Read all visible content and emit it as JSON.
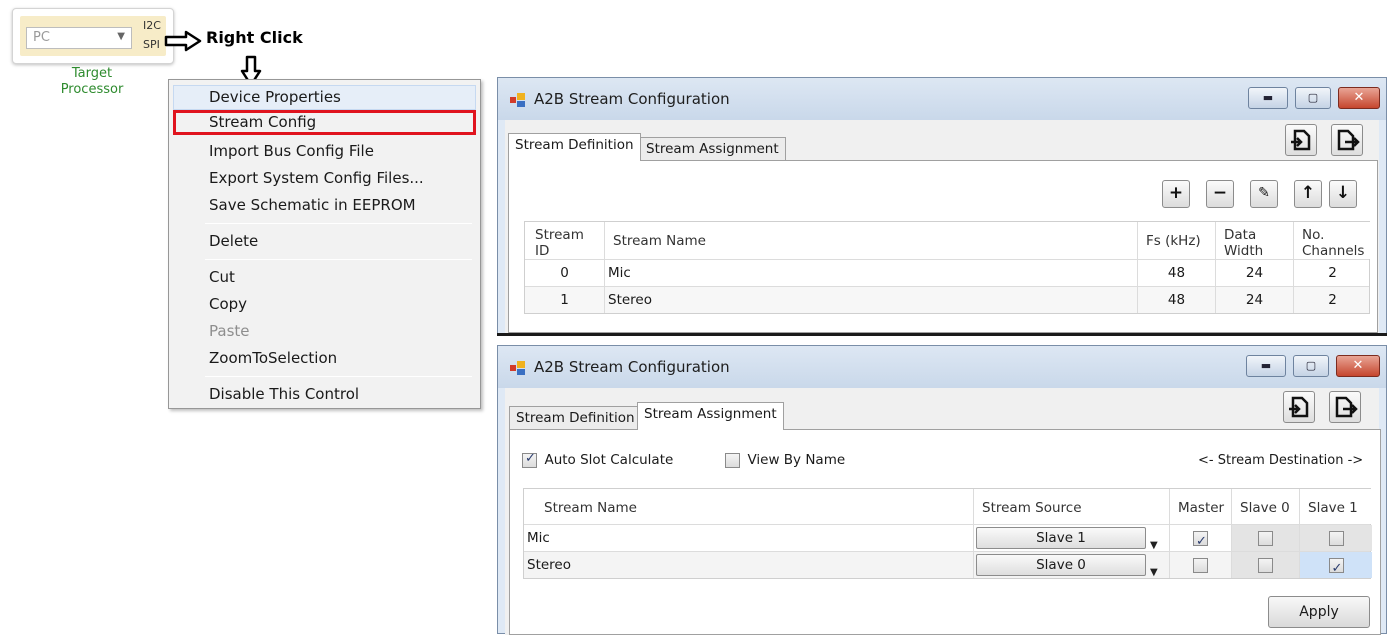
{
  "processor": {
    "combo_value": "PC",
    "tag_i2c": "I2C",
    "tag_spi": "SPI",
    "label_line1": "Target",
    "label_line2": "Processor"
  },
  "annotation": {
    "right_click": "Right Click"
  },
  "context_menu": {
    "items": [
      {
        "label": "Device Properties",
        "enabled": true
      },
      {
        "label": "Stream Config",
        "enabled": true,
        "highlighted": true
      },
      {
        "label": "Import Bus Config File",
        "enabled": true
      },
      {
        "label": "Export System Config Files...",
        "enabled": true
      },
      {
        "label": "Save Schematic in EEPROM",
        "enabled": true
      },
      {
        "label": "Delete",
        "enabled": true
      },
      {
        "label": "Cut",
        "enabled": true
      },
      {
        "label": "Copy",
        "enabled": true
      },
      {
        "label": "Paste",
        "enabled": false
      },
      {
        "label": "ZoomToSelection",
        "enabled": true
      },
      {
        "label": "Disable This Control",
        "enabled": true
      }
    ]
  },
  "window1": {
    "title": "A2B Stream Configuration",
    "tabs": [
      "Stream Definition",
      "Stream Assignment"
    ],
    "active_tab": 0,
    "columns": [
      "Stream ID",
      "Stream Name",
      "Fs (kHz)",
      "Data Width",
      "No. Channels"
    ],
    "rows": [
      {
        "id": "0",
        "name": "Mic",
        "fs": "48",
        "width": "24",
        "channels": "2"
      },
      {
        "id": "1",
        "name": "Stereo",
        "fs": "48",
        "width": "24",
        "channels": "2"
      }
    ]
  },
  "window2": {
    "title": "A2B Stream Configuration",
    "tabs": [
      "Stream Definition",
      "Stream Assignment"
    ],
    "active_tab": 1,
    "auto_slot_label": "Auto Slot Calculate",
    "auto_slot_checked": true,
    "view_by_name_label": "View By Name",
    "view_by_name_checked": false,
    "destination_label": "<- Stream Destination ->",
    "columns": [
      "Stream Name",
      "Stream Source",
      "Master",
      "Slave 0",
      "Slave 1"
    ],
    "rows": [
      {
        "name": "Mic",
        "source": "Slave 1",
        "master": true,
        "slave0": false,
        "slave1": false
      },
      {
        "name": "Stereo",
        "source": "Slave 0",
        "master": false,
        "slave0": false,
        "slave1": true
      }
    ],
    "apply_label": "Apply"
  },
  "colors": {
    "highlight_box": "#e0141e",
    "window_frame": "#dfe9f5",
    "selected_cell": "#cfe2f8"
  }
}
